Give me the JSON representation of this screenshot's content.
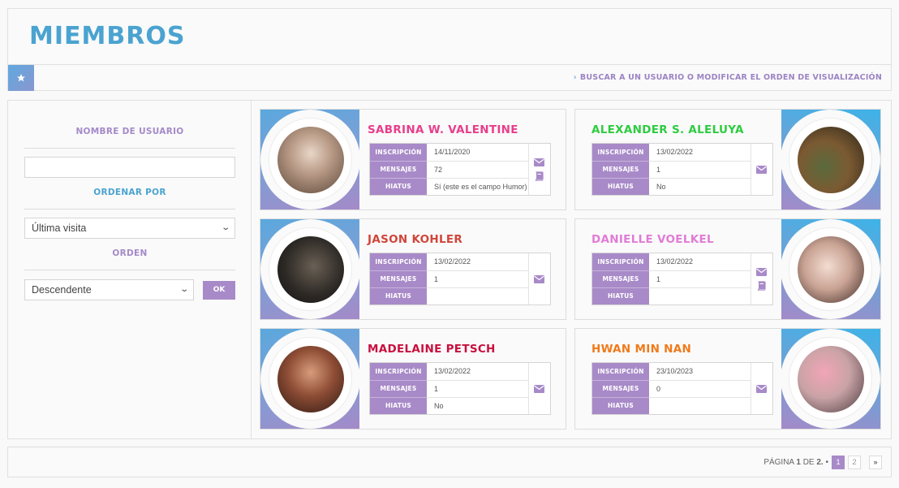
{
  "header": {
    "title": "MIEMBROS",
    "search_link": "BUSCAR A UN USUARIO O MODIFICAR EL ORDEN DE VISUALIZACIÓN"
  },
  "sidebar": {
    "username_label": "NOMBRE DE USUARIO",
    "username_value": "",
    "sort_label": "ORDENAR POR",
    "sort_value": "Última visita",
    "order_label": "ORDEN",
    "order_value": "Descendente",
    "ok_label": "OK"
  },
  "labels": {
    "inscripcion": "INSCRIPCIÓN",
    "mensajes": "MENSAJES",
    "hiatus": "HIATUS"
  },
  "members": [
    {
      "name": "SABRINA W. VALENTINE",
      "color": "#e83e8c",
      "inscripcion": "14/11/2020",
      "mensajes": "72",
      "hiatus": "Sí (este es el campo Humor)",
      "icons": [
        "envelope-icon",
        "book-icon"
      ]
    },
    {
      "name": "ALEXANDER S. ALELUYA",
      "color": "#2ecc40",
      "inscripcion": "13/02/2022",
      "mensajes": "1",
      "hiatus": "No",
      "icons": [
        "envelope-icon"
      ]
    },
    {
      "name": "JASON KOHLER",
      "color": "#d0453a",
      "inscripcion": "13/02/2022",
      "mensajes": "1",
      "hiatus": "",
      "icons": [
        "envelope-icon"
      ]
    },
    {
      "name": "DANIELLE VOELKEL",
      "color": "#e07cd6",
      "inscripcion": "13/02/2022",
      "mensajes": "1",
      "hiatus": "",
      "icons": [
        "envelope-icon",
        "book-icon"
      ]
    },
    {
      "name": "MADELAINE PETSCH",
      "color": "#c8103e",
      "inscripcion": "13/02/2022",
      "mensajes": "1",
      "hiatus": "No",
      "icons": [
        "envelope-icon"
      ]
    },
    {
      "name": "HWAN MIN NAN",
      "color": "#f07a1a",
      "inscripcion": "23/10/2023",
      "mensajes": "0",
      "hiatus": "",
      "icons": [
        "envelope-icon"
      ]
    }
  ],
  "pagination": {
    "prefix": "PÁGINA",
    "current": "1",
    "of": "DE",
    "total": "2.",
    "pages": [
      "1",
      "2"
    ],
    "next": "»"
  },
  "colors": {
    "accent": "#a88ac8",
    "title": "#4aa3d0"
  }
}
